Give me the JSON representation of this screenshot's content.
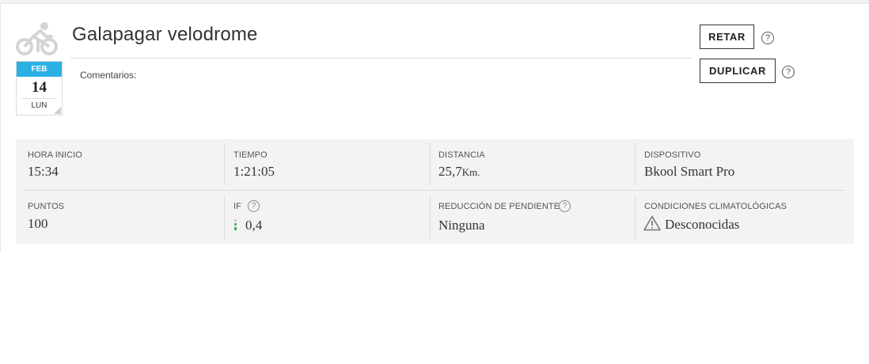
{
  "workout": {
    "title": "Galapagar velodrome",
    "comments_label": "Comentarios:",
    "date": {
      "month": "FEB",
      "day": "14",
      "weekday": "LUN"
    }
  },
  "actions": {
    "retar_label": "RETAR",
    "duplicar_label": "DUPLICAR",
    "help_glyph": "?"
  },
  "stats": {
    "hora_inicio": {
      "label": "HORA INICIO",
      "value": "15:34"
    },
    "tiempo": {
      "label": "TIEMPO",
      "value": "1:21:05"
    },
    "distancia": {
      "label": "DISTANCIA",
      "value": "25,7",
      "unit": "Km."
    },
    "dispositivo": {
      "label": "DISPOSITIVO",
      "value": "Bkool Smart Pro"
    },
    "puntos": {
      "label": "PUNTOS",
      "value": "100"
    },
    "if": {
      "label": "IF",
      "value": "0,4",
      "level": 0.4,
      "bar_color": "#3cb54a"
    },
    "reduccion": {
      "label": "REDUCCIÓN DE PENDIENTE",
      "value": "Ninguna"
    },
    "clima": {
      "label": "CONDICIONES CLIMATOLÓGICAS",
      "value": "Desconocidas"
    }
  },
  "icons": {
    "sport": "bicycle-icon",
    "help": "help-circle-icon",
    "warning": "warning-triangle-icon"
  }
}
